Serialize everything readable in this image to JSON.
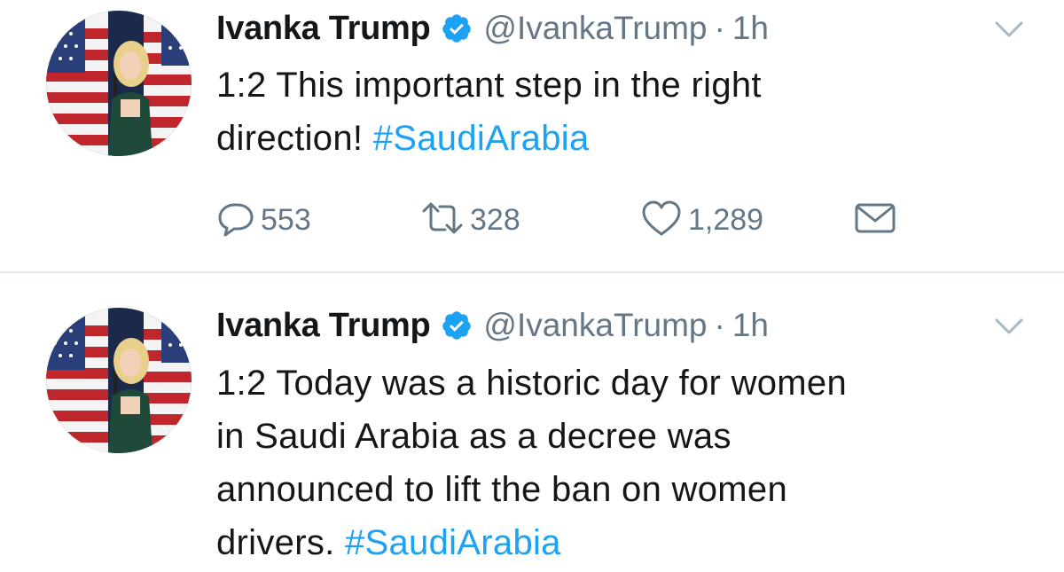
{
  "colors": {
    "text": "#14171a",
    "secondary": "#657786",
    "accent": "#1da1f2",
    "divider": "#e1e8ed"
  },
  "tweets": [
    {
      "author_name": "Ivanka Trump",
      "handle": "@IvankaTrump",
      "separator": "·",
      "time": "1h",
      "text_lines": [
        "1:2 This important step in the right",
        "direction! "
      ],
      "hashtag": "#SaudiArabia",
      "reply_count": "553",
      "retweet_count": "328",
      "like_count": "1,289",
      "icons": [
        "avatar",
        "verified-badge-icon",
        "chevron-down-icon",
        "reply-icon",
        "retweet-icon",
        "heart-icon",
        "envelope-icon"
      ]
    },
    {
      "author_name": "Ivanka Trump",
      "handle": "@IvankaTrump",
      "separator": "·",
      "time": "1h",
      "text_lines": [
        "1:2 Today was a historic day for women",
        "in Saudi Arabia as a decree was",
        "announced to lift the ban on women",
        "drivers. "
      ],
      "hashtag": "#SaudiArabia",
      "icons": [
        "avatar",
        "verified-badge-icon",
        "chevron-down-icon"
      ]
    }
  ]
}
